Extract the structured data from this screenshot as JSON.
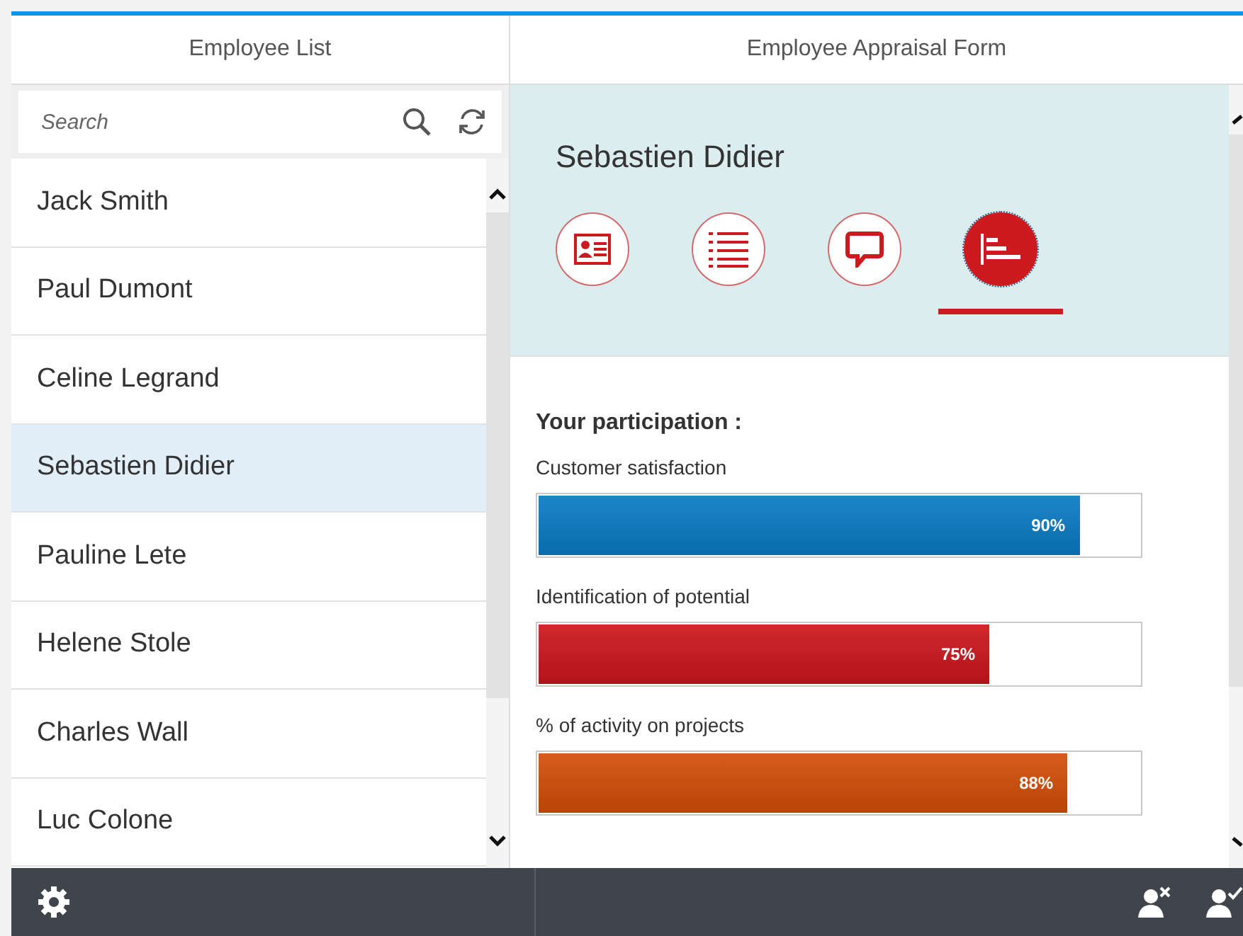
{
  "left_panel": {
    "title": "Employee List",
    "search": {
      "placeholder": "Search"
    },
    "employees": [
      {
        "name": "Jack Smith",
        "selected": false
      },
      {
        "name": "Paul Dumont",
        "selected": false
      },
      {
        "name": "Celine Legrand",
        "selected": false
      },
      {
        "name": "Sebastien Didier",
        "selected": true
      },
      {
        "name": "Pauline Lete",
        "selected": false
      },
      {
        "name": "Helene Stole",
        "selected": false
      },
      {
        "name": "Charles Wall",
        "selected": false
      },
      {
        "name": "Luc Colone",
        "selected": false
      }
    ]
  },
  "right_panel": {
    "title": "Employee Appraisal Form",
    "employee_name": "Sebastien Didier",
    "tabs": [
      {
        "kind": "card",
        "selected": false
      },
      {
        "kind": "list",
        "selected": false
      },
      {
        "kind": "comment",
        "selected": false
      },
      {
        "kind": "chart",
        "selected": true
      }
    ],
    "section_title": "Your participation :",
    "metrics": [
      {
        "label": "Customer satisfaction",
        "value": "90%",
        "level": 0.9,
        "color": "#0a7bc3"
      },
      {
        "label": "Identification of potential",
        "value": "75%",
        "level": 0.75,
        "color": "#cc161c"
      },
      {
        "label": "% of activity on projects",
        "value": "88%",
        "level": 0.88,
        "color": "#d24e08"
      }
    ]
  }
}
